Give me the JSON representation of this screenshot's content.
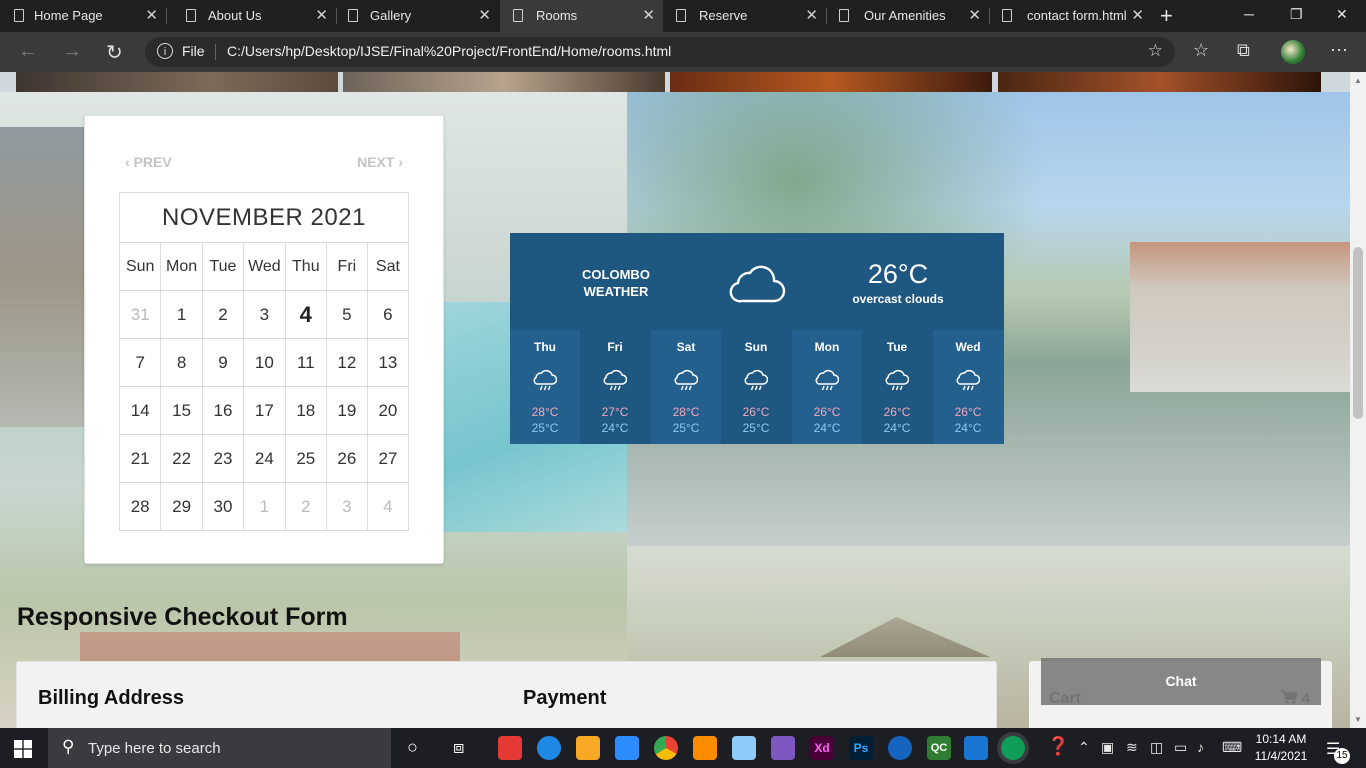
{
  "browser": {
    "tabs": [
      {
        "label": "Home Page",
        "close": "✕"
      },
      {
        "label": "About Us",
        "close": "✕"
      },
      {
        "label": "Gallery",
        "close": "✕"
      },
      {
        "label": "Rooms",
        "close": "✕",
        "active": true
      },
      {
        "label": "Reserve",
        "close": "✕"
      },
      {
        "label": "Our Amenities",
        "close": "✕"
      },
      {
        "label": "contact form.html",
        "close": "✕"
      }
    ],
    "new_tab": "+",
    "address": {
      "scheme_label": "File",
      "url": "C:/Users/hp/Desktop/IJSE/Final%20Project/FrontEnd/Home/rooms.html"
    },
    "window_controls": {
      "minimize": "─",
      "restore": "❐",
      "close": "✕"
    }
  },
  "calendar": {
    "prev": "PREV",
    "next": "NEXT",
    "month_title": "NOVEMBER 2021",
    "weekdays": [
      "Sun",
      "Mon",
      "Tue",
      "Wed",
      "Thu",
      "Fri",
      "Sat"
    ],
    "weeks": [
      [
        "31",
        "1",
        "2",
        "3",
        "4",
        "5",
        "6"
      ],
      [
        "7",
        "8",
        "9",
        "10",
        "11",
        "12",
        "13"
      ],
      [
        "14",
        "15",
        "16",
        "17",
        "18",
        "19",
        "20"
      ],
      [
        "21",
        "22",
        "23",
        "24",
        "25",
        "26",
        "27"
      ],
      [
        "28",
        "29",
        "30",
        "1",
        "2",
        "3",
        "4"
      ]
    ],
    "today": "4"
  },
  "weather": {
    "city": "COLOMBO",
    "label": "WEATHER",
    "temp": "26°C",
    "description": "overcast clouds",
    "icon": "cloud-icon",
    "forecast": [
      {
        "day": "Thu",
        "high": "28°C",
        "low": "25°C",
        "icon": "rain-cloud-icon"
      },
      {
        "day": "Fri",
        "high": "27°C",
        "low": "24°C",
        "icon": "rain-cloud-icon"
      },
      {
        "day": "Sat",
        "high": "28°C",
        "low": "25°C",
        "icon": "rain-cloud-icon"
      },
      {
        "day": "Sun",
        "high": "26°C",
        "low": "25°C",
        "icon": "rain-cloud-icon"
      },
      {
        "day": "Mon",
        "high": "26°C",
        "low": "24°C",
        "icon": "rain-cloud-icon"
      },
      {
        "day": "Tue",
        "high": "26°C",
        "low": "24°C",
        "icon": "rain-cloud-icon"
      },
      {
        "day": "Wed",
        "high": "26°C",
        "low": "24°C",
        "icon": "rain-cloud-icon"
      }
    ]
  },
  "checkout": {
    "title": "Responsive Checkout Form",
    "billing_heading": "Billing Address",
    "payment_heading": "Payment"
  },
  "cart": {
    "title": "Cart",
    "count": "4"
  },
  "chat": {
    "label": "Chat"
  },
  "taskbar": {
    "search_placeholder": "Type here to search",
    "time": "10:14 AM",
    "date": "11/4/2021",
    "notification_count": "15"
  },
  "colors": {
    "weather_bg": "#1e5780",
    "weather_high": "#f3a6bd",
    "weather_low": "#8fc9f2",
    "tab_active": "#3a3a3a"
  }
}
